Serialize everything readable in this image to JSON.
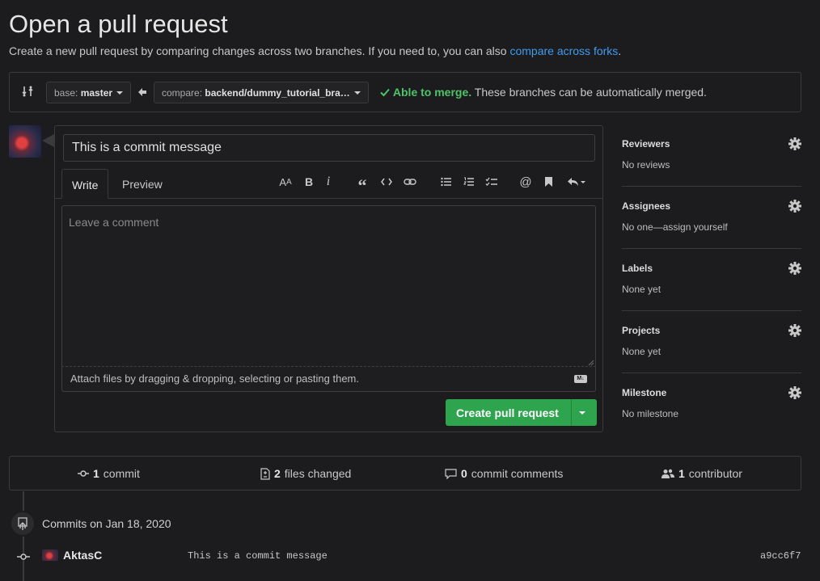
{
  "page": {
    "title": "Open a pull request",
    "subtitle_text": "Create a new pull request by comparing changes across two branches. If you need to, you can also",
    "subtitle_link": "compare across forks",
    "subtitle_end": "."
  },
  "branches": {
    "base_prefix": "base:",
    "base_value": "master",
    "compare_prefix": "compare:",
    "compare_value": "backend/dummy_tutorial_bra…",
    "merge_status": "Able to merge.",
    "merge_detail": "These branches can be automatically merged.",
    "merge_color": "#4fc36a"
  },
  "composer": {
    "title_value": "This is a commit message",
    "tabs": [
      "Write",
      "Preview"
    ],
    "toolbar_icons": [
      "text-size-icon",
      "bold-icon",
      "italic-icon",
      "quote-icon",
      "code-icon",
      "link-icon",
      "bullet-list-icon",
      "numbered-list-icon",
      "task-list-icon",
      "mention-icon",
      "saved-reply-icon",
      "reply-icon"
    ],
    "body_placeholder": "Leave a comment",
    "attach_text": "Attach files by dragging & dropping, selecting or pasting them.",
    "markdown_badge": "M↓",
    "submit_label": "Create pull request",
    "submit_color": "#2ea44f"
  },
  "sidebar": [
    {
      "heading": "Reviewers",
      "value": "No reviews"
    },
    {
      "heading": "Assignees",
      "value": "No one—assign yourself"
    },
    {
      "heading": "Labels",
      "value": "None yet"
    },
    {
      "heading": "Projects",
      "value": "None yet"
    },
    {
      "heading": "Milestone",
      "value": "No milestone"
    }
  ],
  "stats": {
    "commits_count": "1",
    "commits_label": "commit",
    "files_count": "2",
    "files_label": "files changed",
    "comments_count": "0",
    "comments_label": "commit comments",
    "contributors_count": "1",
    "contributors_label": "contributor"
  },
  "timeline": {
    "commits_on": "Commits on Jan 18, 2020",
    "commit": {
      "author": "AktasC",
      "message": "This is a commit message",
      "sha": "a9cc6f7"
    }
  }
}
